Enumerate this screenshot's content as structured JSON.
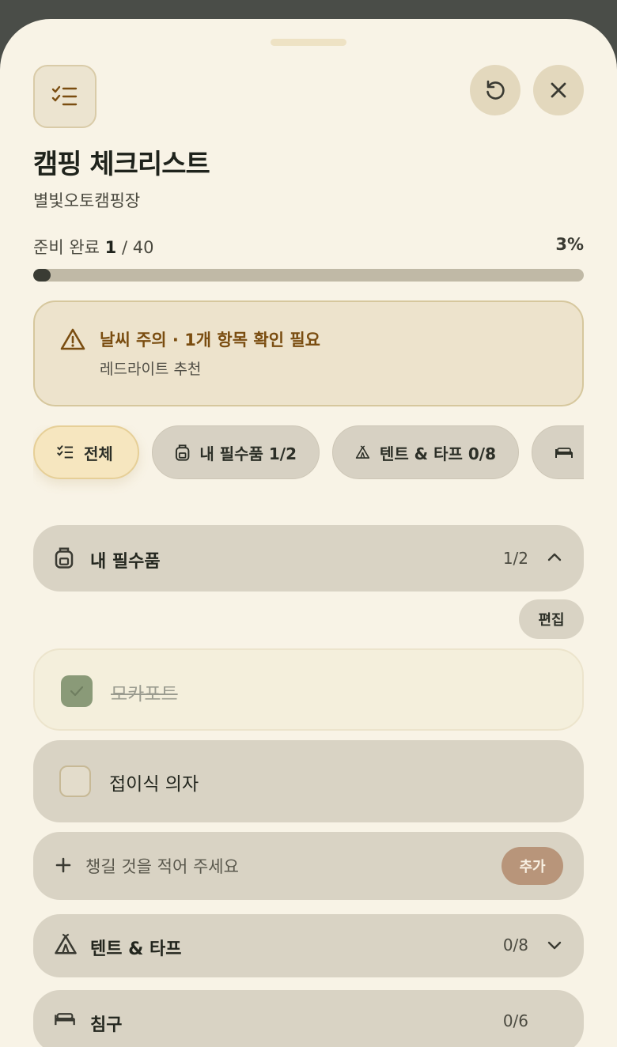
{
  "header": {
    "title": "캠핑 체크리스트",
    "subtitle": "별빛오토캠핑장"
  },
  "progress": {
    "label": "준비 완료",
    "done": "1",
    "total": "/ 40",
    "percent_text": "3%",
    "fraction": 0.025
  },
  "warning": {
    "title": "날씨 주의 · 1개 항목 확인 필요",
    "subtitle": "레드라이트 추천"
  },
  "chips": [
    {
      "label": "전체",
      "icon": "checklist-icon",
      "active": true
    },
    {
      "label": "내 필수품 1/2",
      "icon": "backpack-icon",
      "active": false
    },
    {
      "label": "텐트 & 타프 0/8",
      "icon": "tent-icon",
      "active": false
    },
    {
      "label": "",
      "icon": "bed-icon",
      "active": false
    }
  ],
  "sections": {
    "essentials": {
      "title": "내 필수품",
      "count": "1/2",
      "expanded": true
    },
    "tent": {
      "title": "텐트 & 타프",
      "count": "0/8",
      "expanded": false
    },
    "sleep": {
      "title": "침구",
      "count": "0/6"
    }
  },
  "edit_label": "편집",
  "items": [
    {
      "text": "모카포트",
      "checked": true
    },
    {
      "text": "접이식 의자",
      "checked": false
    }
  ],
  "add": {
    "placeholder": "챙길 것을 적어 주세요",
    "button_label": "추가"
  },
  "colors": {
    "background": "#f8f3e6",
    "accent": "#b8957a",
    "warning_text": "#7a4d10",
    "checked": "#8a9a78"
  }
}
